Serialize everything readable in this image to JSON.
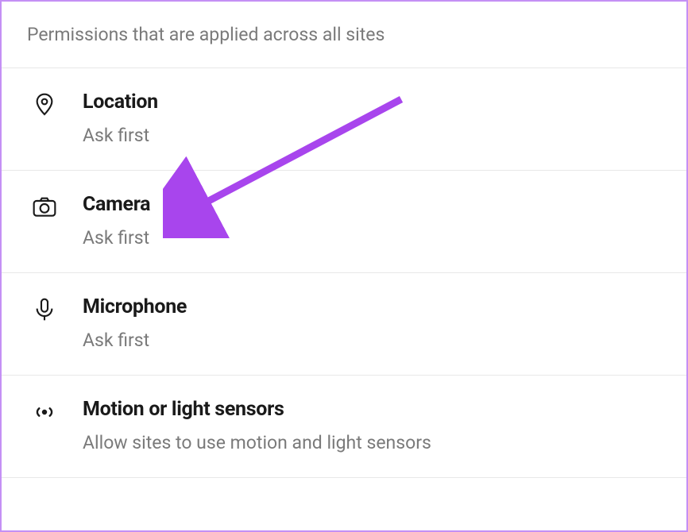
{
  "header": {
    "description": "Permissions that are applied across all sites"
  },
  "permissions": [
    {
      "icon": "location-icon",
      "title": "Location",
      "subtitle": "Ask first"
    },
    {
      "icon": "camera-icon",
      "title": "Camera",
      "subtitle": "Ask first"
    },
    {
      "icon": "microphone-icon",
      "title": "Microphone",
      "subtitle": "Ask first"
    },
    {
      "icon": "motion-sensor-icon",
      "title": "Motion or light sensors",
      "subtitle": "Allow sites to use motion and light sensors"
    }
  ]
}
